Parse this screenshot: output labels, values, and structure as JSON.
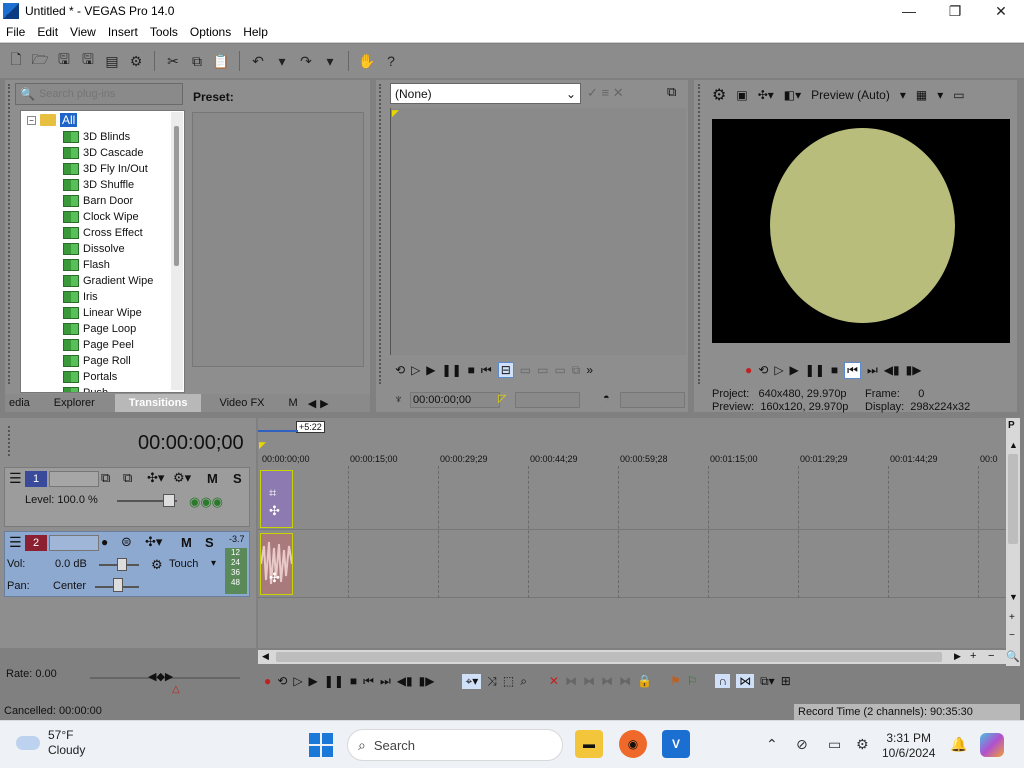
{
  "window": {
    "title": "Untitled * - VEGAS Pro 14.0",
    "minimize": "—",
    "maximize": "❐",
    "close": "✕"
  },
  "menu": [
    "File",
    "Edit",
    "View",
    "Insert",
    "Tools",
    "Options",
    "Help"
  ],
  "explorer": {
    "search_placeholder": "Search plug-ins",
    "preset_label": "Preset:",
    "root": "All",
    "items": [
      "3D Blinds",
      "3D Cascade",
      "3D Fly In/Out",
      "3D Shuffle",
      "Barn Door",
      "Clock Wipe",
      "Cross Effect",
      "Dissolve",
      "Flash",
      "Gradient Wipe",
      "Iris",
      "Linear Wipe",
      "Page Loop",
      "Page Peel",
      "Page Roll",
      "Portals",
      "Push"
    ],
    "tabs": [
      "edia",
      "Explorer",
      "Transitions",
      "Video FX",
      "M"
    ]
  },
  "trimmer": {
    "select_value": "(None)",
    "time": "00:00:00;00"
  },
  "preview": {
    "mode": "Preview (Auto)",
    "project_label": "Project:",
    "project_value": "640x480, 29.970p",
    "preview_label": "Preview:",
    "preview_value": "160x120, 29.970p",
    "frame_label": "Frame:",
    "frame_value": "0",
    "display_label": "Display:",
    "display_value": "298x224x32",
    "colors": {
      "circle": "#b9bd7c",
      "screen": "#000000"
    }
  },
  "timeline": {
    "timecode": "00:00:00;00",
    "marker": "+5:22",
    "ruler": [
      "00:00:00;00",
      "00:00:15;00",
      "00:00:29;29",
      "00:00:44;29",
      "00:00:59;28",
      "00:01:15;00",
      "00:01:29;29",
      "00:01:44;29",
      "00:0"
    ],
    "track1": {
      "number": "1",
      "level_label": "Level: 100.0 %",
      "m": "M",
      "s": "S"
    },
    "track2": {
      "number": "2",
      "vol_label": "Vol:",
      "vol_value": "0.0 dB",
      "pan_label": "Pan:",
      "pan_value": "Center",
      "touch": "Touch",
      "m": "M",
      "s": "S",
      "meter_top": "-3.7",
      "meter": [
        "12",
        "24",
        "36",
        "48"
      ]
    }
  },
  "transport": {
    "rate": "Rate: 0.00"
  },
  "status": {
    "left": "Cancelled: 00:00:00",
    "right": "Record Time (2 channels): 90:35:30"
  },
  "taskbar": {
    "temp": "57°F",
    "condition": "Cloudy",
    "search": "Search",
    "time": "3:31 PM",
    "date": "10/6/2024"
  }
}
